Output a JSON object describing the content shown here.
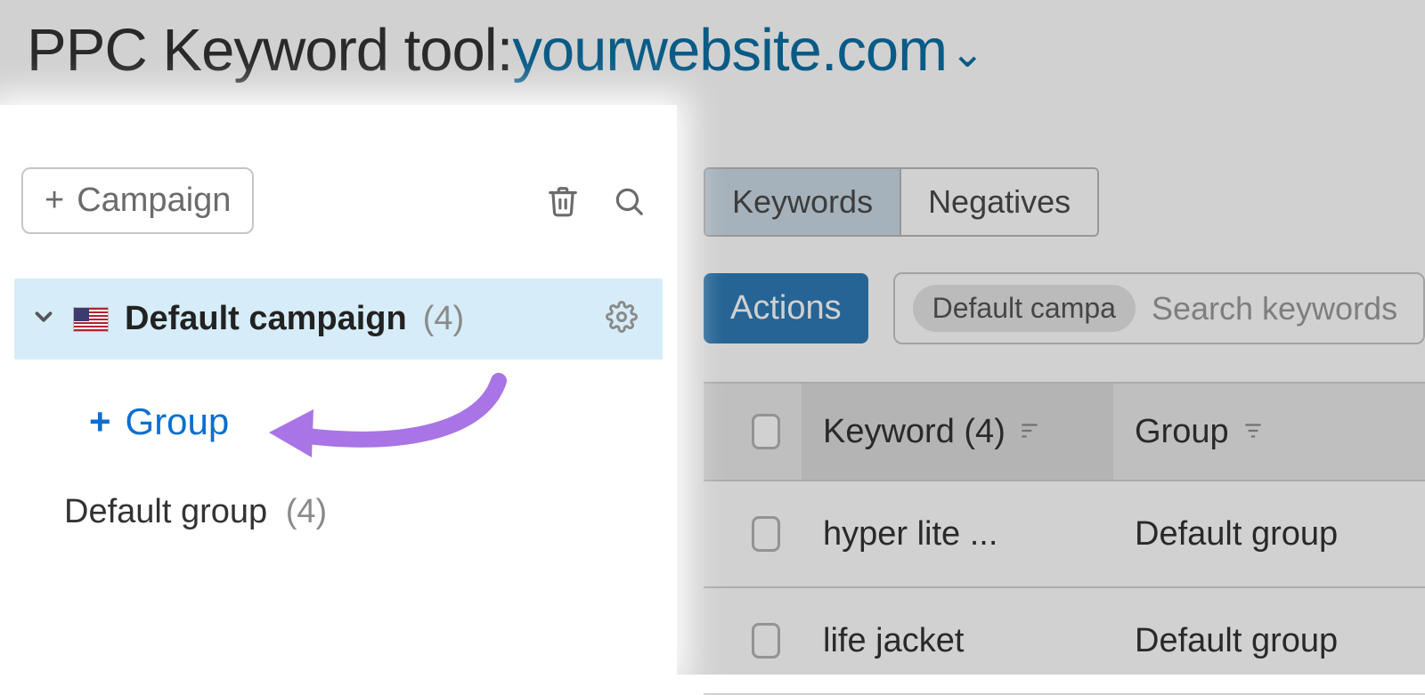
{
  "header": {
    "title_prefix": "PPC Keyword tool:",
    "site": "yourwebsite.com"
  },
  "sidebar": {
    "add_campaign_label": "Campaign",
    "campaign": {
      "name": "Default campaign",
      "count": "(4)"
    },
    "add_group_label": "Group",
    "group": {
      "name": "Default group",
      "count": "(4)"
    }
  },
  "tabs": {
    "keywords": "Keywords",
    "negatives": "Negatives"
  },
  "toolbar": {
    "actions_label": "Actions",
    "campaign_tag": "Default campa",
    "search_placeholder": "Search keywords"
  },
  "table": {
    "columns": {
      "keyword": "Keyword (4)",
      "group": "Group"
    },
    "rows": [
      {
        "keyword": "hyper lite ...",
        "group": "Default group"
      },
      {
        "keyword": "life jacket",
        "group": "Default group"
      }
    ]
  }
}
